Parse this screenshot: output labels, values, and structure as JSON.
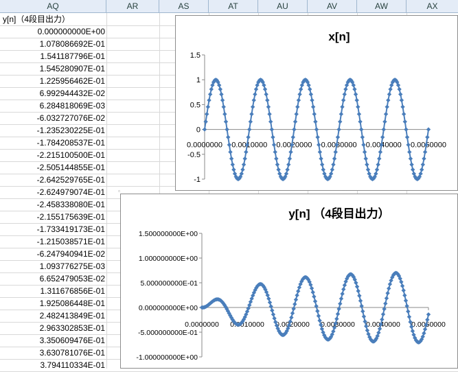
{
  "columns": [
    "AQ",
    "AR",
    "AS",
    "AT",
    "AU",
    "AV",
    "AW",
    "AX"
  ],
  "header_cell": "y[n]（4段目出力）",
  "values": [
    "0.000000000E+00",
    "1.078086692E-01",
    "1.541187796E-01",
    "1.545280907E-01",
    "1.225956462E-01",
    "6.992944432E-02",
    "6.284818069E-03",
    "-6.032727076E-02",
    "-1.235230225E-01",
    "-1.784208537E-01",
    "-2.215100500E-01",
    "-2.505144855E-01",
    "-2.642529765E-01",
    "-2.624979074E-01",
    "-2.458338080E-01",
    "-2.155175639E-01",
    "-1.733419173E-01",
    "-1.215038571E-01",
    "-6.247940941E-02",
    "1.093776275E-03",
    "6.652479053E-02",
    "1.311676856E-01",
    "1.925086448E-01",
    "2.482413849E-01",
    "2.963302853E-01",
    "3.350609476E-01",
    "3.630781076E-01",
    "3.794110334E-01"
  ],
  "chart_data": [
    {
      "type": "scatter",
      "title": "x[n]",
      "y_ticks": [
        "1.5",
        "1",
        "0.5",
        "0",
        "-0.5",
        "-1"
      ],
      "x_ticks": [
        "0.0000000",
        "0.0010000",
        "0.0020000",
        "0.0030000",
        "0.0040000",
        "0.0050000"
      ],
      "ylim": [
        -1,
        1.5
      ],
      "xlim": [
        0,
        0.005
      ],
      "marker_color": "#4a7ebb",
      "series_x_range": [
        0,
        0.005
      ],
      "series_formula": "sin(2*pi*1000*x)",
      "point_count": 200
    },
    {
      "type": "scatter",
      "title": "y[n] （4段目出力）",
      "y_ticks": [
        "1.500000000E+00",
        "1.000000000E+00",
        "5.000000000E-01",
        "0.000000000E+00",
        "-5.000000000E-01",
        "-1.000000000E+00"
      ],
      "x_ticks": [
        "0.0000000",
        "0.0010000",
        "0.0020000",
        "0.0030000",
        "0.0040000",
        "0.0050000"
      ],
      "ylim": [
        -1,
        1.5
      ],
      "xlim": [
        0,
        0.005
      ],
      "marker_color": "#4a7ebb",
      "series_x_range": [
        0,
        0.005
      ],
      "point_count": 200
    }
  ]
}
